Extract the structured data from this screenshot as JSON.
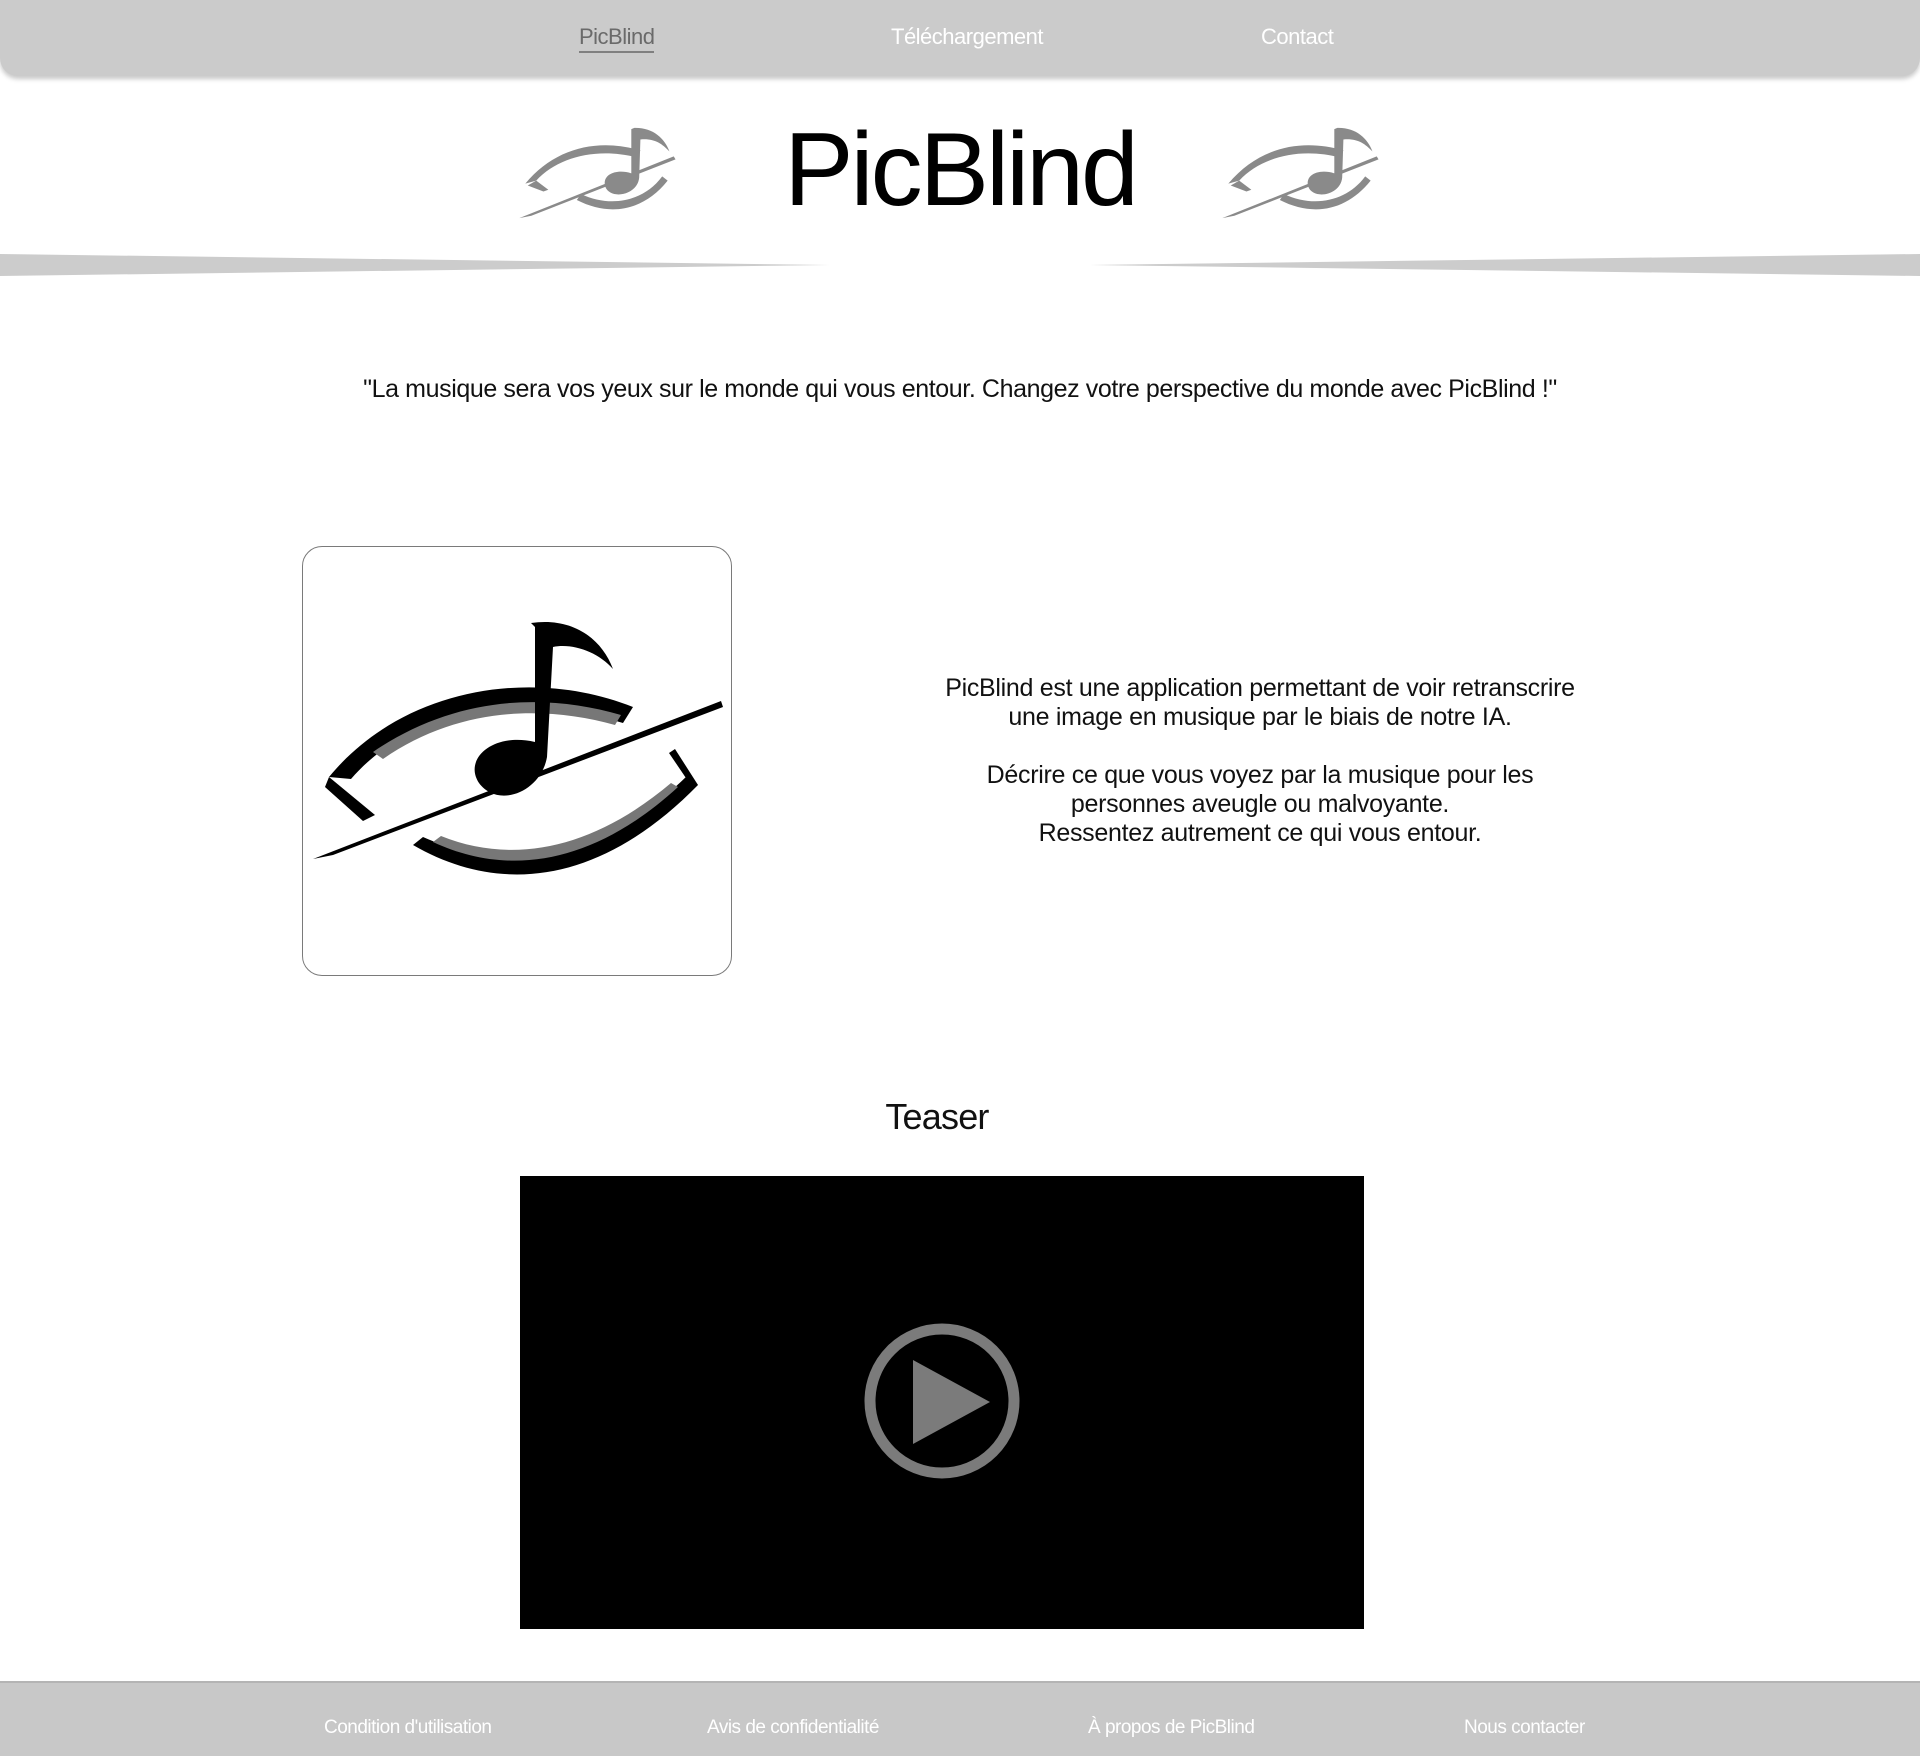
{
  "nav": {
    "items": [
      {
        "label": "PicBlind",
        "active": true
      },
      {
        "label": "Téléchargement",
        "active": false
      },
      {
        "label": "Contact",
        "active": false
      }
    ]
  },
  "header": {
    "title": "PicBlind",
    "logo_icon": "eye-music-note-icon"
  },
  "slogan": "\"La musique sera vos yeux sur le monde qui vous entour. Changez votre perspective du monde avec PicBlind !\"",
  "intro": {
    "paragraph1": [
      "PicBlind est une application permettant de voir retranscrire",
      "une image en musique par le biais de notre IA."
    ],
    "paragraph2": [
      "Décrire ce que vous voyez par la musique pour les",
      "personnes aveugle ou malvoyante.",
      "Ressentez autrement ce qui vous entour."
    ]
  },
  "teaser": {
    "title": "Teaser",
    "play_icon": "play-icon"
  },
  "footer": {
    "links": [
      "Condition d'utilisation",
      "Avis de confidentialité",
      "À propos de PicBlind",
      "Nous contacter"
    ]
  },
  "colors": {
    "nav_bg": "#cbcbcb",
    "footer_bg": "#c8c8c8",
    "nav_active": "#6a6a6a",
    "link_text": "#ffffff",
    "logo_grey": "#8a8a8a",
    "video_bg": "#000000",
    "play_grey": "#7b7b7b"
  }
}
